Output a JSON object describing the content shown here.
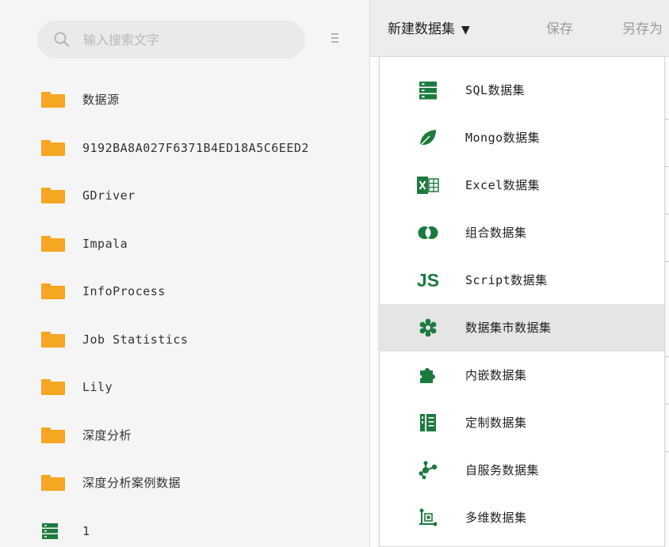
{
  "colors": {
    "folder": "#f5a623",
    "icon_green": "#1d7a3e",
    "sidebar_bg": "#f5f5f5",
    "toolbar_bg": "#ededed",
    "active_item_bg": "#e5e5e5"
  },
  "sidebar": {
    "search": {
      "placeholder": "输入搜索文字",
      "value": ""
    },
    "tree": [
      {
        "label": "数据源",
        "icon": "folder-icon"
      },
      {
        "label": "9192BA8A027F6371B4ED18A5C6EED2",
        "icon": "folder-icon"
      },
      {
        "label": "GDriver",
        "icon": "folder-icon"
      },
      {
        "label": "Impala",
        "icon": "folder-icon"
      },
      {
        "label": "InfoProcess",
        "icon": "folder-icon"
      },
      {
        "label": "Job Statistics",
        "icon": "folder-icon"
      },
      {
        "label": "Lily",
        "icon": "folder-icon"
      },
      {
        "label": "深度分析",
        "icon": "folder-icon"
      },
      {
        "label": "深度分析案例数据",
        "icon": "folder-icon"
      },
      {
        "label": "1",
        "icon": "sql-dataset-icon"
      }
    ]
  },
  "toolbar": {
    "new_label": "新建数据集",
    "new_caret": "▼",
    "save_label": "保存",
    "saveas_label": "另存为"
  },
  "menu": {
    "items": [
      {
        "label": "SQL数据集",
        "icon": "sql-dataset-icon",
        "active": false
      },
      {
        "label": "Mongo数据集",
        "icon": "mongo-leaf-icon",
        "active": false
      },
      {
        "label": "Excel数据集",
        "icon": "excel-icon",
        "active": false
      },
      {
        "label": "组合数据集",
        "icon": "combine-circles-icon",
        "active": false
      },
      {
        "label": "Script数据集",
        "icon": "script-js-icon",
        "icon_text": "JS",
        "active": false
      },
      {
        "label": "数据集市数据集",
        "icon": "datamart-gear-icon",
        "active": true
      },
      {
        "label": "内嵌数据集",
        "icon": "puzzle-icon",
        "active": false
      },
      {
        "label": "定制数据集",
        "icon": "custom-book-icon",
        "active": false
      },
      {
        "label": "自服务数据集",
        "icon": "self-service-network-icon",
        "active": false
      },
      {
        "label": "多维数据集",
        "icon": "multidim-cube-icon",
        "active": false
      }
    ]
  }
}
